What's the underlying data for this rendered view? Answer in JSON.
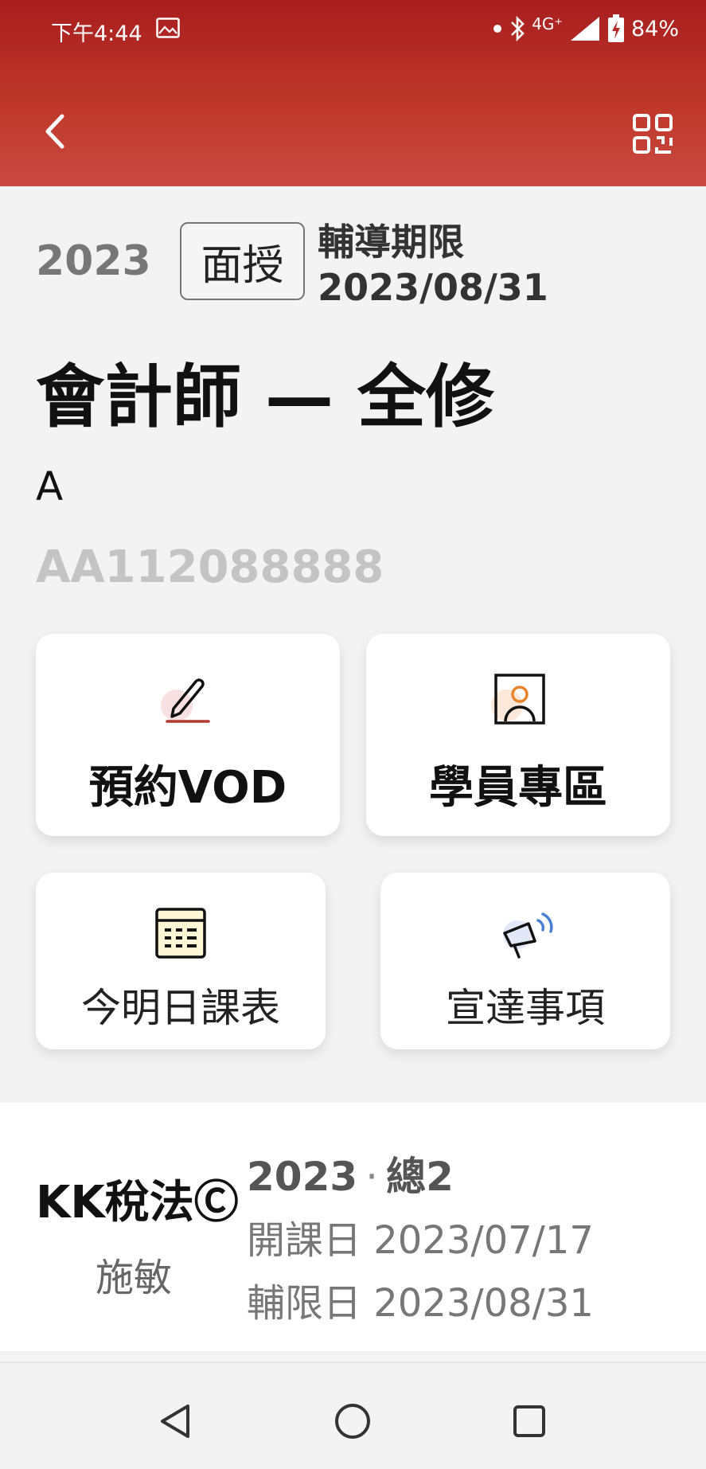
{
  "status_bar": {
    "time": "下午4:44",
    "network": "4G⁺",
    "battery": "84%"
  },
  "header": {
    "back_icon": "chevron-left-icon",
    "qr_icon": "qr-code-icon"
  },
  "course": {
    "year": "2023",
    "mode_badge": "面授",
    "deadline": "輔導期限 2023/08/31",
    "title": "會計師 — 全修",
    "student_name": "A",
    "student_id": "AA112088888"
  },
  "cards": [
    {
      "label": "預約VOD",
      "icon": "pencil-icon"
    },
    {
      "label": "學員專區",
      "icon": "user-portrait-icon"
    },
    {
      "label": "今明日課表",
      "icon": "calendar-icon"
    },
    {
      "label": "宣達事項",
      "icon": "megaphone-icon"
    }
  ],
  "class_info": {
    "subject": "KK稅法Ⓒ",
    "teacher": "施敏",
    "year": "2023",
    "dot": "·",
    "class_no": "總2",
    "start_date": "開課日 2023/07/17",
    "end_date": "輔限日 2023/08/31"
  },
  "nav": {
    "back_icon": "triangle-back-icon",
    "home_icon": "circle-home-icon",
    "recent_icon": "square-recents-icon"
  },
  "colors": {
    "header_top": "#a81e1e",
    "header_bottom": "#c94a43",
    "accent_orange": "#e8842c",
    "accent_red": "#b03a30",
    "accent_blue": "#4a7fd1"
  }
}
